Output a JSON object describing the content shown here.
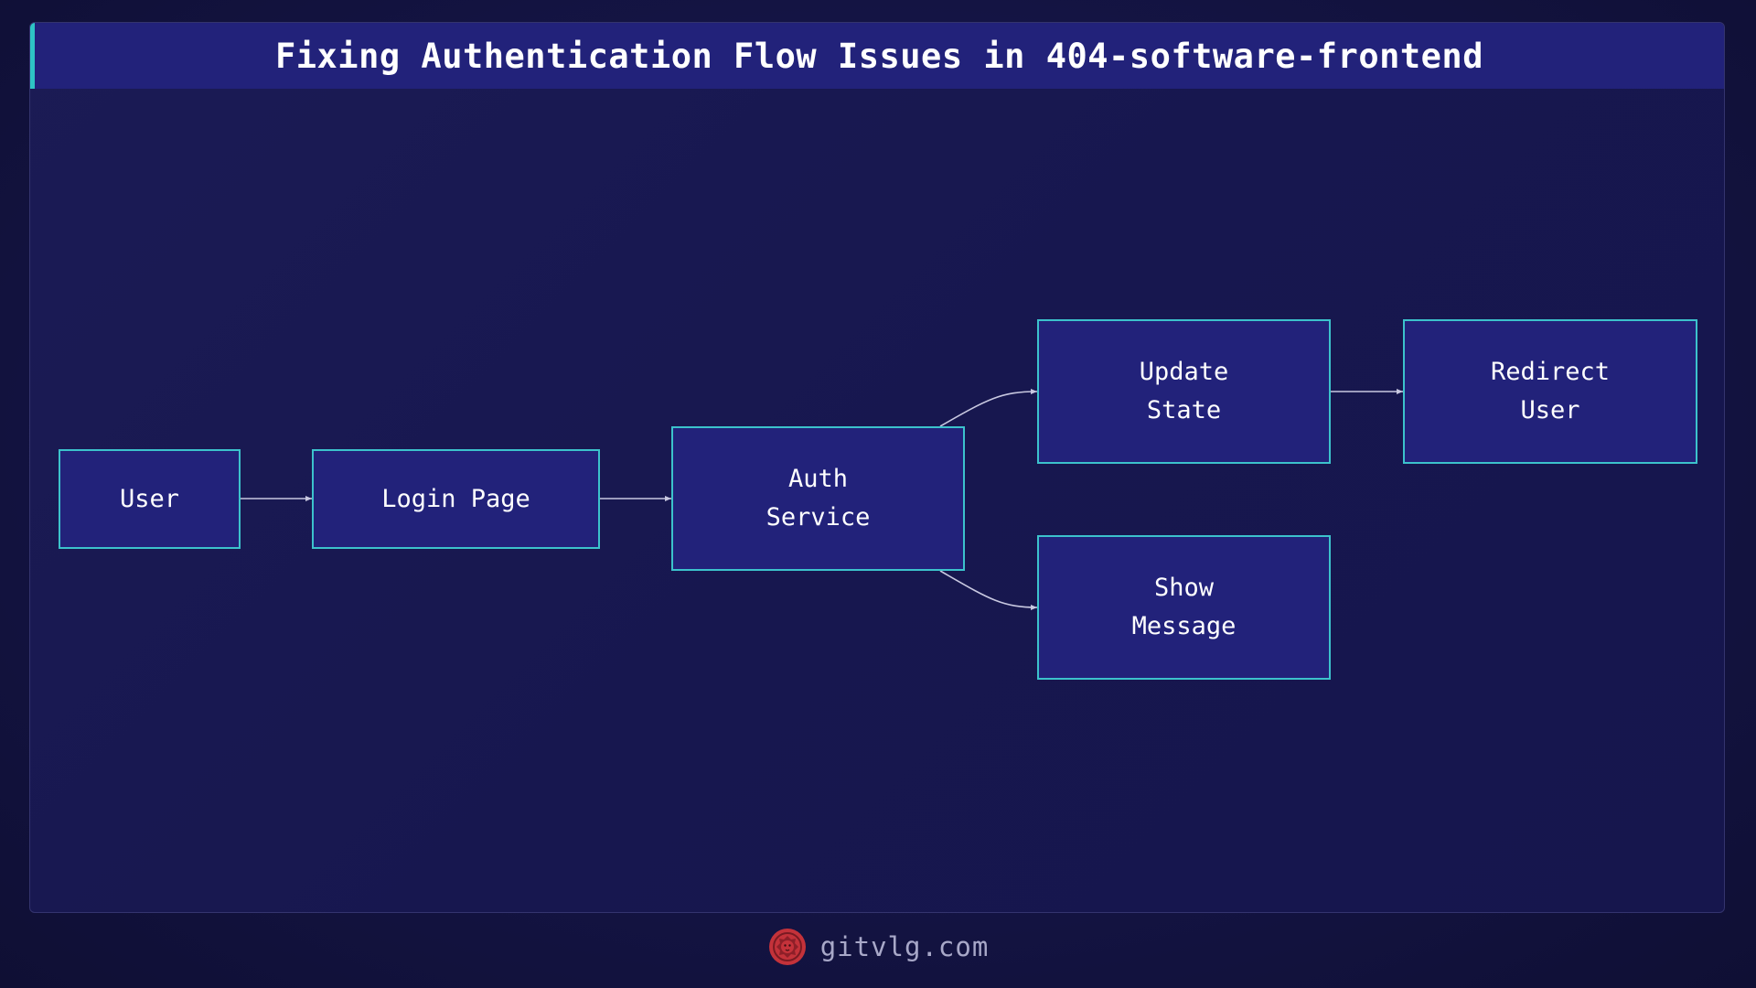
{
  "title": "Fixing Authentication Flow Issues in 404-software-frontend",
  "nodes": {
    "user": {
      "line1": "User"
    },
    "login": {
      "line1": "Login Page"
    },
    "auth": {
      "line1": "Auth",
      "line2": "Service"
    },
    "update": {
      "line1": "Update",
      "line2": "State"
    },
    "redirect": {
      "line1": "Redirect",
      "line2": "User"
    },
    "message": {
      "line1": "Show",
      "line2": "Message"
    }
  },
  "edges": [
    {
      "from": "user",
      "to": "login"
    },
    {
      "from": "login",
      "to": "auth"
    },
    {
      "from": "auth",
      "to": "update"
    },
    {
      "from": "auth",
      "to": "message"
    },
    {
      "from": "update",
      "to": "redirect"
    }
  ],
  "footer": {
    "site": "gitvlg.com",
    "logo_icon": "lion-head-icon"
  },
  "colors": {
    "background": "#15154a",
    "node_fill": "#22227a",
    "node_border": "#3cc2cc",
    "accent": "#2ec4c4",
    "edge": "#c8c8e0",
    "logo": "#c4323a"
  }
}
